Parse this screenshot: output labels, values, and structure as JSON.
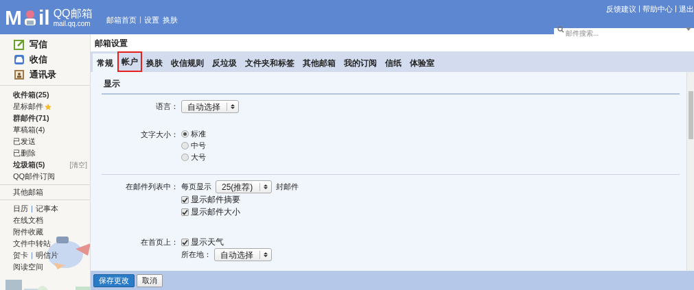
{
  "header": {
    "logo_left": "M",
    "logo_right": "il",
    "brand": "QQ邮箱",
    "domain": "mail.qq.com",
    "nav": [
      "邮箱首页",
      "设置",
      "换肤"
    ],
    "top_links": [
      "反馈建议",
      "帮助中心",
      "退出"
    ],
    "search": {
      "placeholder": "邮件搜索..."
    }
  },
  "sidebar": {
    "actions": [
      {
        "label": "写信",
        "kind": "compose"
      },
      {
        "label": "收信",
        "kind": "inbox"
      },
      {
        "label": "通讯录",
        "kind": "contacts"
      }
    ],
    "folders": [
      {
        "label": "收件箱(25)",
        "bold": true
      },
      {
        "label": "星标邮件",
        "bold": false,
        "star": true
      },
      {
        "label": "群邮件(71)",
        "bold": true
      },
      {
        "label": "草稿箱(4)",
        "bold": false
      },
      {
        "label": "已发送",
        "bold": false
      },
      {
        "label": "已删除",
        "bold": false
      },
      {
        "label": "垃圾箱(5)",
        "bold": true,
        "action": "[清空]"
      },
      {
        "label": "QQ邮件订阅",
        "bold": false
      }
    ],
    "other": "其他邮箱",
    "tools": [
      [
        "日历",
        "记事本"
      ],
      [
        "在线文档"
      ],
      [
        "附件收藏"
      ],
      [
        "文件中转站"
      ],
      [
        "贺卡",
        "明信片"
      ],
      [
        "阅读空间"
      ]
    ]
  },
  "main": {
    "title": "邮箱设置",
    "tabs": [
      {
        "label": "常规",
        "selected": true,
        "highlighted": false
      },
      {
        "label": "帐户",
        "selected": false,
        "highlighted": true
      },
      {
        "label": "换肤",
        "selected": false,
        "highlighted": false
      },
      {
        "label": "收信规则",
        "selected": false,
        "highlighted": false
      },
      {
        "label": "反垃圾",
        "selected": false,
        "highlighted": false
      },
      {
        "label": "文件夹和标签",
        "selected": false,
        "highlighted": false
      },
      {
        "label": "其他邮箱",
        "selected": false,
        "highlighted": false
      },
      {
        "label": "我的订阅",
        "selected": false,
        "highlighted": false
      },
      {
        "label": "信纸",
        "selected": false,
        "highlighted": false
      },
      {
        "label": "体验室",
        "selected": false,
        "highlighted": false
      }
    ],
    "section": "显示",
    "rows": [
      {
        "kind": "select",
        "label": "语言：",
        "value": "自动选择"
      },
      {
        "kind": "radio",
        "label": "文字大小：",
        "options": [
          {
            "label": "标准",
            "selected": true
          },
          {
            "label": "中号",
            "selected": false
          },
          {
            "label": "大号",
            "selected": false
          }
        ]
      },
      {
        "kind": "list",
        "label": "在邮件列表中：",
        "divider_before": true,
        "prefix": "每页显示",
        "value": "25(推荐)",
        "suffix": "封邮件",
        "options": [
          {
            "label": "显示邮件摘要",
            "checked": true
          },
          {
            "label": "显示邮件大小",
            "checked": true
          }
        ]
      },
      {
        "kind": "home",
        "label": "在首页上：",
        "options": [
          {
            "label": "显示天气",
            "checked": true
          }
        ],
        "sublabel": "所在地：",
        "value": "自动选择"
      }
    ],
    "buttons": [
      {
        "label": "保存更改",
        "kind": "primary"
      },
      {
        "label": "取消",
        "kind": "secondary"
      }
    ]
  }
}
